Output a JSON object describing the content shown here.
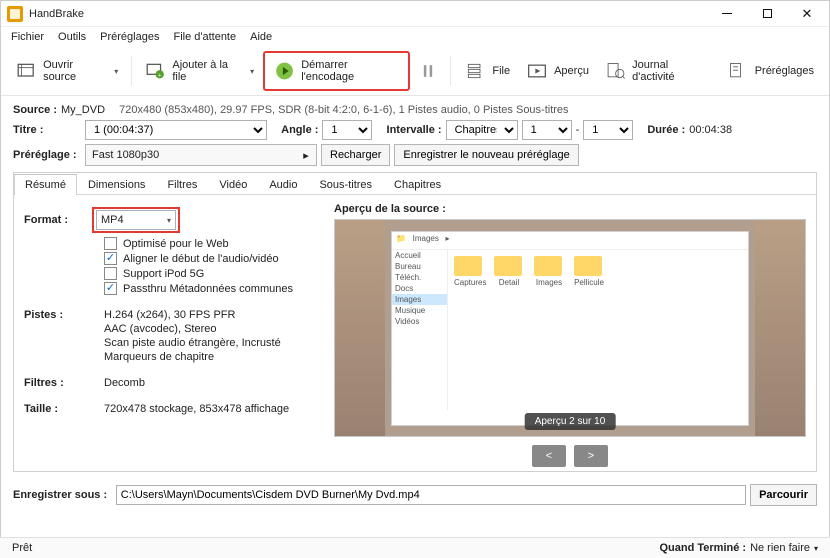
{
  "title": "HandBrake",
  "menu": [
    "Fichier",
    "Outils",
    "Préréglages",
    "File d'attente",
    "Aide"
  ],
  "toolbar": {
    "open_source": "Ouvrir source",
    "add_queue": "Ajouter à la file",
    "start_encode": "Démarrer l'encodage",
    "pause": "Pause",
    "queue": "File",
    "preview": "Aperçu",
    "activity": "Journal d'activité",
    "presets": "Préréglages"
  },
  "source": {
    "label": "Source :",
    "name": "My_DVD",
    "info": "720x480 (853x480), 29.97 FPS, SDR (8-bit 4:2:0, 6-1-6), 1 Pistes audio, 0 Pistes Sous-titres"
  },
  "title_row": {
    "label": "Titre :",
    "value": "1  (00:04:37)",
    "angle_label": "Angle :",
    "angle_value": "1",
    "range_label": "Intervalle :",
    "range_type": "Chapitres",
    "range_from": "1",
    "range_to": "1",
    "dash": "-",
    "duration_label": "Durée :",
    "duration_value": "00:04:38"
  },
  "preset_row": {
    "label": "Préréglage :",
    "value": "Fast 1080p30",
    "reload": "Recharger",
    "save": "Enregistrer le nouveau préréglage"
  },
  "tabs": [
    "Résumé",
    "Dimensions",
    "Filtres",
    "Vidéo",
    "Audio",
    "Sous-titres",
    "Chapitres"
  ],
  "summary": {
    "format_label": "Format :",
    "format_value": "MP4",
    "cb_web": "Optimisé pour le Web",
    "cb_align": "Aligner le début de l'audio/vidéo",
    "cb_ipod": "Support iPod 5G",
    "cb_meta": "Passthru Métadonnées communes",
    "tracks_label": "Pistes :",
    "tracks": [
      "H.264 (x264), 30 FPS PFR",
      "AAC (avcodec), Stereo",
      "Scan piste audio étrangère, Incrusté",
      "Marqueurs de chapitre"
    ],
    "filters_label": "Filtres :",
    "filters_value": "Decomb",
    "size_label": "Taille :",
    "size_value": "720x478 stockage, 853x478 affichage"
  },
  "preview": {
    "label": "Aperçu de la source :",
    "badge": "Aperçu 2 sur 10",
    "prev": "<",
    "next": ">"
  },
  "save": {
    "label": "Enregistrer sous :",
    "path": "C:\\Users\\Mayn\\Documents\\Cisdem DVD Burner\\My Dvd.mp4",
    "browse": "Parcourir"
  },
  "status": {
    "left": "Prêt",
    "done_label": "Quand Terminé :",
    "done_value": "Ne rien faire"
  }
}
